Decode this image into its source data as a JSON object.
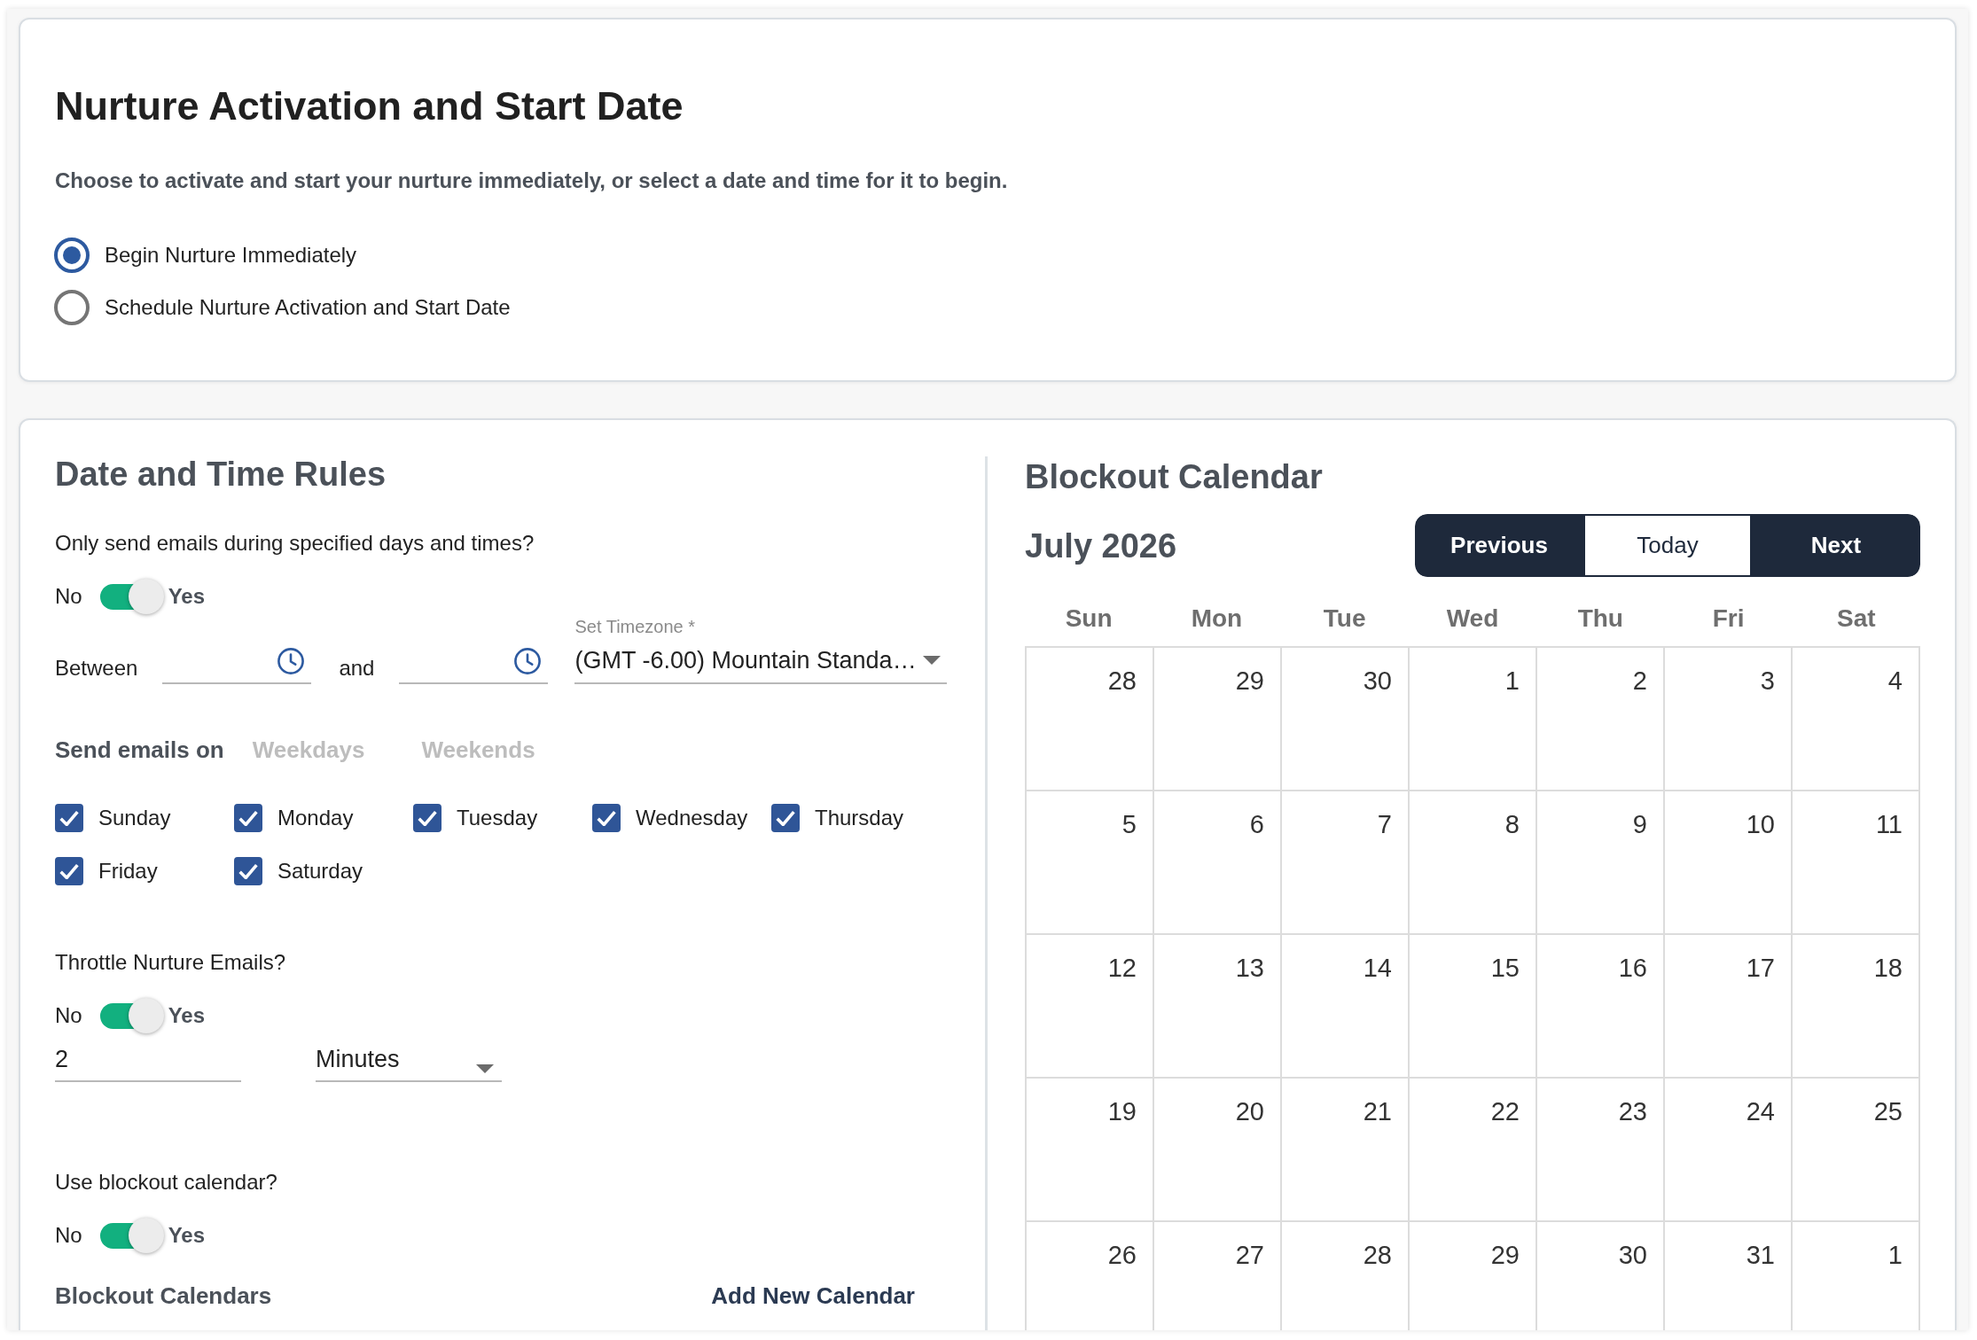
{
  "activation_card": {
    "title": "Nurture Activation and Start Date",
    "description": "Choose to activate and start your nurture immediately, or select a date and time for it to begin.",
    "options": [
      {
        "label": "Begin Nurture Immediately",
        "selected": true
      },
      {
        "label": "Schedule Nurture Activation and Start Date",
        "selected": false
      }
    ]
  },
  "date_time_rules": {
    "title": "Date and Time Rules",
    "restrict_question": "Only send emails during specified days and times?",
    "restrict_toggle": {
      "off_label": "No",
      "on_label": "Yes",
      "on": true
    },
    "time_range": {
      "label": "Between",
      "joiner": "and"
    },
    "timezone": {
      "label": "Set Timezone *",
      "value": "(GMT -6.00) Mountain Standa…"
    },
    "send_days": {
      "label": "Send emails on",
      "presets": [
        {
          "label": "Weekdays",
          "selected": false
        },
        {
          "label": "Weekends",
          "selected": false
        }
      ],
      "days": [
        {
          "label": "Sunday",
          "checked": true
        },
        {
          "label": "Monday",
          "checked": true
        },
        {
          "label": "Tuesday",
          "checked": true
        },
        {
          "label": "Wednesday",
          "checked": true
        },
        {
          "label": "Thursday",
          "checked": true
        },
        {
          "label": "Friday",
          "checked": true
        },
        {
          "label": "Saturday",
          "checked": true
        }
      ]
    },
    "throttle": {
      "question": "Throttle Nurture Emails?",
      "toggle": {
        "off_label": "No",
        "on_label": "Yes",
        "on": true
      },
      "amount": "2",
      "unit": "Minutes"
    },
    "blockout": {
      "question": "Use blockout calendar?",
      "toggle": {
        "off_label": "No",
        "on_label": "Yes",
        "on": true
      },
      "list_title": "Blockout Calendars",
      "add_link": "Add New Calendar"
    }
  },
  "blockout_calendar": {
    "title": "Blockout Calendar",
    "month": "July 2026",
    "nav_buttons": [
      {
        "label": "Previous",
        "disabled": false
      },
      {
        "label": "Today",
        "disabled": true
      },
      {
        "label": "Next",
        "disabled": false
      }
    ],
    "weekdays": [
      "Sun",
      "Mon",
      "Tue",
      "Wed",
      "Thu",
      "Fri",
      "Sat"
    ],
    "weeks": [
      [
        "28",
        "29",
        "30",
        "1",
        "2",
        "3",
        "4"
      ],
      [
        "5",
        "6",
        "7",
        "8",
        "9",
        "10",
        "11"
      ],
      [
        "12",
        "13",
        "14",
        "15",
        "16",
        "17",
        "18"
      ],
      [
        "19",
        "20",
        "21",
        "22",
        "23",
        "24",
        "25"
      ],
      [
        "26",
        "27",
        "28",
        "29",
        "30",
        "31",
        "1"
      ]
    ]
  }
}
